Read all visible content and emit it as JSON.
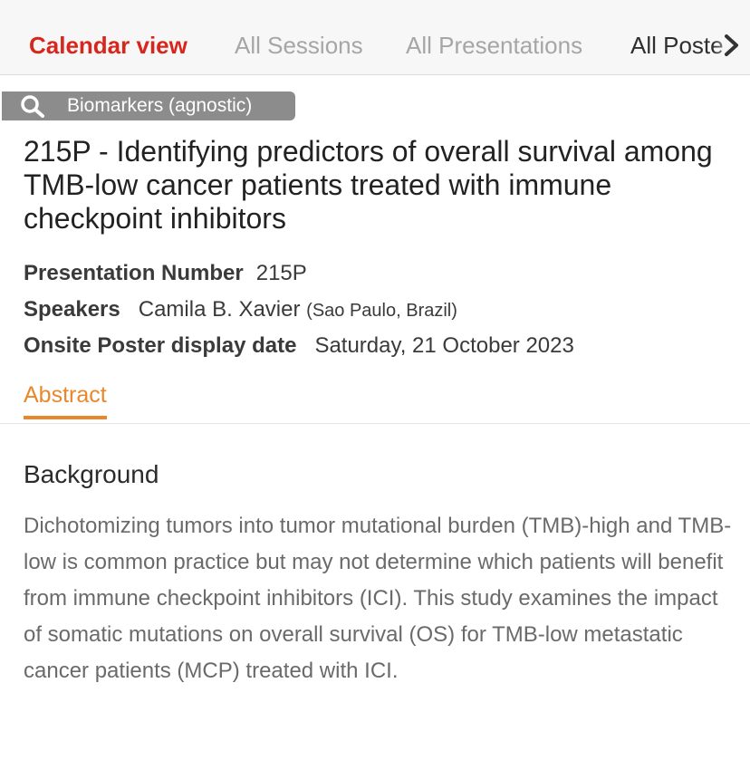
{
  "tabs": [
    {
      "label": "Calendar view",
      "active": true
    },
    {
      "label": "All Sessions",
      "active": false
    },
    {
      "label": "All Presentations",
      "active": false
    },
    {
      "label": "All Poste",
      "active": false
    }
  ],
  "topic": {
    "label": "Biomarkers (agnostic)",
    "icon": "search-icon"
  },
  "presentation": {
    "title": "215P - Identifying predictors of overall survival among TMB-low cancer patients treated with immune checkpoint inhibitors",
    "number_label": "Presentation Number",
    "number_value": "215P",
    "speakers_label": "Speakers",
    "speaker_name": "Camila B. Xavier",
    "speaker_location": "(Sao Paulo, Brazil)",
    "date_label": "Onsite Poster display date",
    "date_value": "Saturday, 21 October 2023"
  },
  "abstract_tab": {
    "label": "Abstract"
  },
  "background": {
    "heading": "Background",
    "text": "Dichotomizing tumors into tumor mutational burden (TMB)-high and TMB-low is common practice but may not determine which patients will benefit from immune checkpoint inhibitors (ICI). This study examines the impact of somatic mutations on overall survival (OS) for TMB-low metastatic cancer patients (MCP) treated with ICI."
  },
  "colors": {
    "active_tab": "#d8261c",
    "inactive_tab": "#a6a6a6",
    "accent_orange": "#e8882b",
    "pill_bg": "#8c8c8c"
  }
}
